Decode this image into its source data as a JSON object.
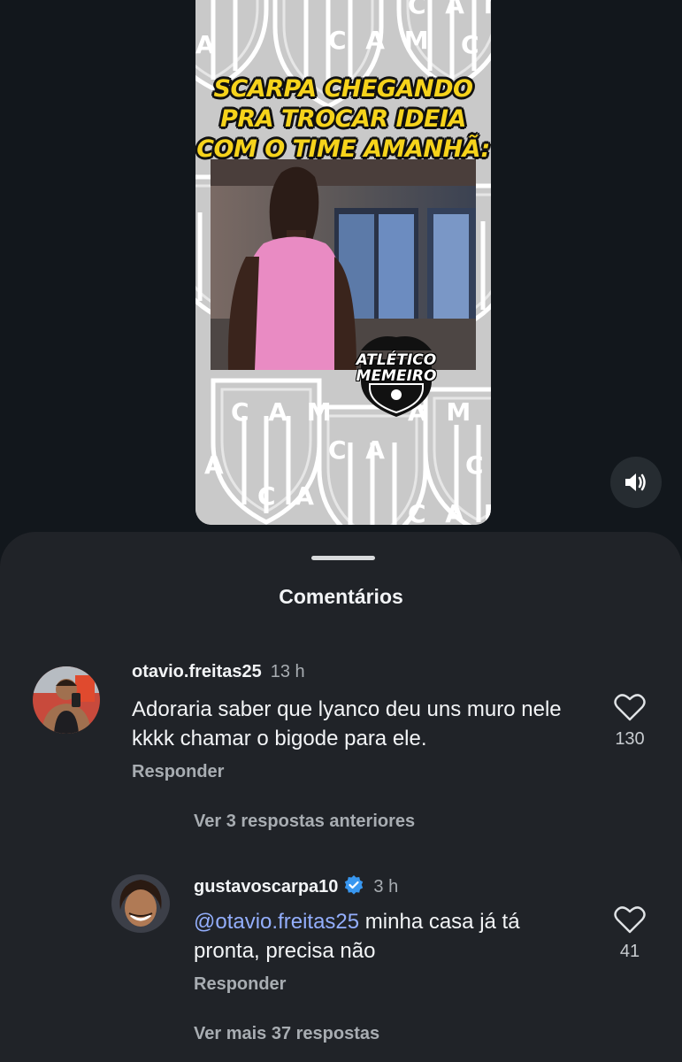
{
  "video": {
    "caption_lines": [
      "SCARPA CHEGANDO",
      "PRA TROCAR IDEIA",
      "COM O TIME AMANHÃ:"
    ],
    "pattern_text": "CAM",
    "badge_line1": "ATLÉTICO",
    "badge_line2": "MEMEIRO",
    "sound_icon": "speaker-icon"
  },
  "comments_sheet": {
    "title": "Comentários",
    "comments": [
      {
        "username": "otavio.freitas25",
        "time": "13 h",
        "text": "Adoraria saber que lyanco deu uns muro nele kkkk chamar o bigode para ele.",
        "reply_label": "Responder",
        "likes": "130",
        "view_replies": "Ver 3 respostas anteriores"
      },
      {
        "username": "gustavoscarpa10",
        "verified": true,
        "time": "3 h",
        "mention": "@otavio.freitas25",
        "text": " minha casa já tá pronta, precisa não",
        "reply_label": "Responder",
        "likes": "41",
        "view_replies": "Ver mais 37 respostas"
      }
    ]
  },
  "colors": {
    "background": "#12171c",
    "sheet": "#202328",
    "mention": "#93aefc",
    "caption": "#f6d31b",
    "verified": "#3897f0"
  }
}
